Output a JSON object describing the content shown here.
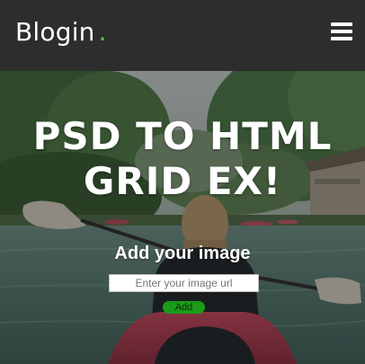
{
  "header": {
    "logo_text": "Blogin",
    "logo_dot": ".",
    "menu_icon": "hamburger-menu-icon"
  },
  "hero": {
    "title_line_1": "PSD TO HTML",
    "title_line_2": "GRID EX!",
    "background": "kayaking-lake-photo",
    "upload": {
      "heading": "Add your image",
      "input_placeholder": "Enter your image url",
      "input_value": "",
      "button_label": "Add"
    }
  },
  "colors": {
    "header_bg": "#2d2d2d",
    "logo_dot": "#6cc04a",
    "add_button_bg": "#1a9b1a",
    "text": "#ffffff"
  }
}
